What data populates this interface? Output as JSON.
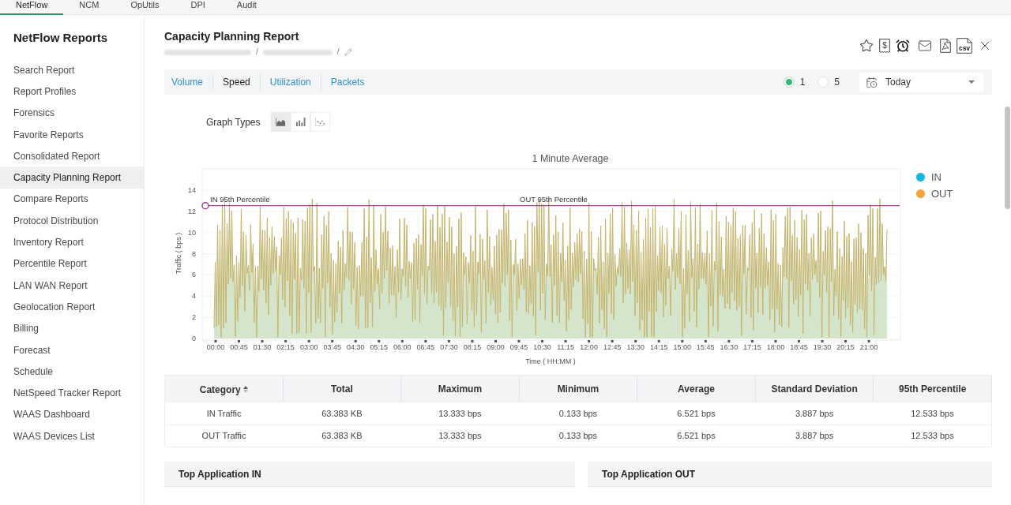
{
  "top_nav": [
    {
      "label": "NetFlow",
      "selected": true
    },
    {
      "label": "NCM",
      "selected": false
    },
    {
      "label": "OpUtils",
      "selected": false
    },
    {
      "label": "DPI",
      "selected": false
    },
    {
      "label": "Audit",
      "selected": false
    }
  ],
  "sidebar": {
    "title": "NetFlow Reports",
    "items": [
      {
        "label": "Search Report",
        "selected": false
      },
      {
        "label": "Report Profiles",
        "selected": false
      },
      {
        "label": "Forensics",
        "selected": false
      },
      {
        "label": "Favorite Reports",
        "selected": false
      },
      {
        "label": "Consolidated Report",
        "selected": false
      },
      {
        "label": "Capacity Planning Report",
        "selected": true
      },
      {
        "label": "Compare Reports",
        "selected": false
      },
      {
        "label": "Protocol Distribution",
        "selected": false
      },
      {
        "label": "Inventory Report",
        "selected": false
      },
      {
        "label": "Percentile Report",
        "selected": false
      },
      {
        "label": "LAN WAN Report",
        "selected": false
      },
      {
        "label": "Geolocation Report",
        "selected": false
      },
      {
        "label": "Billing",
        "selected": false
      },
      {
        "label": "Forecast",
        "selected": false
      },
      {
        "label": "Schedule",
        "selected": false
      },
      {
        "label": "NetSpeed Tracker Report",
        "selected": false
      },
      {
        "label": "WAAS Dashboard",
        "selected": false
      },
      {
        "label": "WAAS Devices List",
        "selected": false
      }
    ]
  },
  "report": {
    "title": "Capacity Planning Report",
    "breadcrumb_separators": [
      "/",
      "/"
    ],
    "toolbar": {
      "receipt_symbol": "$",
      "file_label": "csv"
    }
  },
  "report_tabs": [
    {
      "label": "Volume",
      "selected": false
    },
    {
      "label": "Speed",
      "selected": true
    },
    {
      "label": "Utilization",
      "selected": false
    },
    {
      "label": "Packets",
      "selected": false
    }
  ],
  "resolution_options": [
    {
      "label": "1",
      "selected": true
    },
    {
      "label": "5",
      "selected": false
    }
  ],
  "date_range": {
    "value": "Today"
  },
  "graph_types": {
    "label": "Graph Types",
    "options": [
      {
        "kind": "area",
        "selected": true
      },
      {
        "kind": "bar",
        "selected": false
      },
      {
        "kind": "scatter",
        "selected": false
      }
    ]
  },
  "chart": {
    "title": "1 Minute Average",
    "ylabel": "Traffic ( bps )",
    "xlabel": "Time ( HH:MM )",
    "yticks": [
      "14",
      "12",
      "10",
      "8",
      "6",
      "4",
      "2",
      "0"
    ],
    "xticks": [
      "00:00",
      "00:45",
      "01:30",
      "02:15",
      "03:00",
      "03:45",
      "04:30",
      "05:15",
      "06:00",
      "06:45",
      "07:30",
      "08:15",
      "09:00",
      "09:45",
      "10:30",
      "11:15",
      "12:00",
      "12:45",
      "13:30",
      "14:15",
      "15:00",
      "15:45",
      "16:30",
      "17:15",
      "18:00",
      "18:45",
      "19:30",
      "20:15",
      "21:00"
    ],
    "reference_lines": [
      "IN 95th Percentile",
      "OUT 95th Percentile"
    ],
    "legend": [
      {
        "label": "IN",
        "color": "#17b8e0"
      },
      {
        "label": "OUT",
        "color": "#f0a43a"
      }
    ]
  },
  "table": {
    "columns": [
      {
        "label": "Category",
        "sortable": true
      },
      {
        "label": "Total",
        "sortable": false
      },
      {
        "label": "Maximum",
        "sortable": false
      },
      {
        "label": "Minimum",
        "sortable": false
      },
      {
        "label": "Average",
        "sortable": false
      },
      {
        "label": "Standard Deviation",
        "sortable": false
      },
      {
        "label": "95th Percentile",
        "sortable": false
      }
    ],
    "rows": [
      [
        "IN Traffic",
        "63.383 KB",
        "13.333 bps",
        "0.133 bps",
        "6.521 bps",
        "3.887 bps",
        "12.533 bps"
      ],
      [
        "OUT Traffic",
        "63.383 KB",
        "13.333 bps",
        "0.133 bps",
        "6.521 bps",
        "3.887 bps",
        "12.533 bps"
      ]
    ]
  },
  "panels": [
    "Top Application IN",
    "Top Application OUT"
  ]
}
